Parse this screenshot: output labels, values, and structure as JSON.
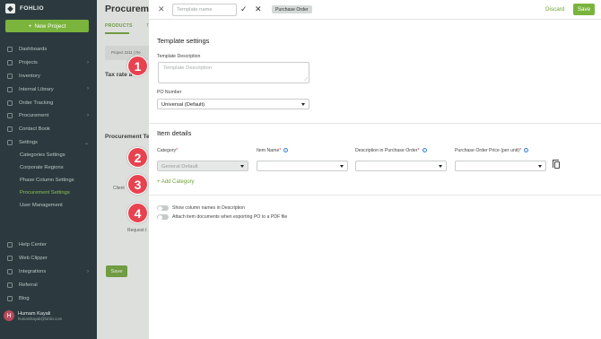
{
  "sidebar": {
    "logo": "FOHLIO",
    "new_project": "New Project",
    "items": [
      {
        "label": "Dashboards"
      },
      {
        "label": "Projects",
        "chevron": "›"
      },
      {
        "label": "Inventory"
      },
      {
        "label": "Internal Library",
        "chevron": "›"
      },
      {
        "label": "Order Tracking"
      },
      {
        "label": "Procurement",
        "chevron": "›"
      },
      {
        "label": "Contact Book"
      },
      {
        "label": "Settings",
        "chevron": "⌄"
      }
    ],
    "subitems": [
      {
        "label": "Categories Settings"
      },
      {
        "label": "Corporate Regions"
      },
      {
        "label": "Phase Column Settings"
      },
      {
        "label": "Procurement Settings",
        "active": true
      },
      {
        "label": "User Management"
      }
    ],
    "bottom_items": [
      {
        "label": "Help Center"
      },
      {
        "label": "Web Clipper"
      },
      {
        "label": "Integrations",
        "chevron": "›"
      },
      {
        "label": "Referral"
      },
      {
        "label": "Blog"
      }
    ],
    "user": {
      "initial": "H",
      "name": "Humam Kayali",
      "email": "humamkayali@fohlio.com"
    }
  },
  "background": {
    "title": "Procurement",
    "tab_products": "PRODUCTS",
    "tab_second": "T",
    "card_text": "Project 2211 | Re",
    "tax_heading": "Tax rate a",
    "procurement_heading": "Procurement Te",
    "client_text": "Client",
    "request_text": "Request t",
    "save": "Save"
  },
  "toolbar": {
    "template_name_placeholder": "Template name",
    "badge": "Purchase Order",
    "discard": "Discard",
    "save": "Save"
  },
  "template_settings": {
    "title": "Template settings",
    "description_label": "Template Description",
    "description_placeholder": "Template Description",
    "po_number_label": "PO Number",
    "po_number_value": "Universal (Default)"
  },
  "item_details": {
    "title": "Item details",
    "columns": {
      "category": "Category",
      "item_name": "Item Name",
      "description_po": "Description in Purchase Order",
      "price_po": "Purchase Order Price (per unit)"
    },
    "category_value": "General Default",
    "add_category": "+ Add Category"
  },
  "options": {
    "show_column_names": "Show column names in Description",
    "attach_documents": "Attach item documents when exporting PO to a PDF file"
  },
  "markers": [
    "1",
    "2",
    "3",
    "4"
  ],
  "colors": {
    "accent": "#7ab43d",
    "sidebar": "#2c3a40",
    "marker": "#e8424f",
    "info": "#3c82d6"
  }
}
